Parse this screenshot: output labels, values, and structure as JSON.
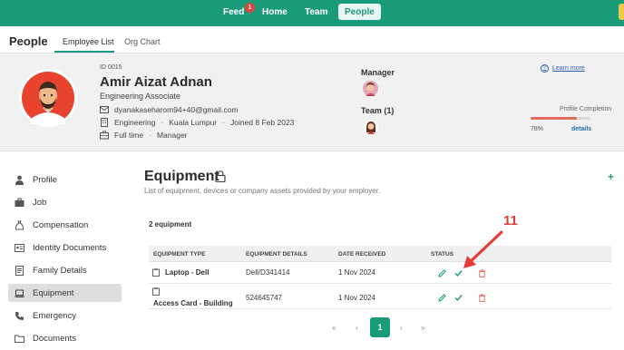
{
  "colors": {
    "brand": "#1a9b7a",
    "badge": "#e0433a",
    "delete": "#e36a5a",
    "link": "#2d5fb7",
    "annotation": "#e53935"
  },
  "topnav": {
    "items": [
      {
        "label": "Feed",
        "badge": "1"
      },
      {
        "label": "Home"
      },
      {
        "label": "Team"
      },
      {
        "label": "People",
        "active": true
      }
    ]
  },
  "page": {
    "title": "People",
    "tabs": [
      {
        "label": "Employee List",
        "active": true
      },
      {
        "label": "Org Chart"
      }
    ]
  },
  "profile": {
    "id": "ID 0015",
    "name": "Amir Aizat Adnan",
    "role": "Engineering Associate",
    "email": "dyanakaseharom94+40@gmail.com",
    "department": "Engineering",
    "location": "Kuala Lumpur",
    "joined": "Joined 8 Feb 2023",
    "employment_type": "Full time",
    "position_level": "Manager",
    "manager_label": "Manager",
    "team_label": "Team (1)",
    "learn_more": "Learn more",
    "completion_label": "Profile Completion",
    "completion_value": "78%",
    "completion_fraction": 0.78,
    "details_link": "details"
  },
  "sidebar": {
    "items": [
      {
        "label": "Profile",
        "icon": "person-icon"
      },
      {
        "label": "Job",
        "icon": "briefcase-icon"
      },
      {
        "label": "Compensation",
        "icon": "money-bag-icon"
      },
      {
        "label": "Identity Documents",
        "icon": "id-card-icon"
      },
      {
        "label": "Family Details",
        "icon": "document-icon"
      },
      {
        "label": "Equipment",
        "icon": "laptop-icon",
        "active": true
      },
      {
        "label": "Emergency",
        "icon": "phone-icon"
      },
      {
        "label": "Documents",
        "icon": "folder-icon"
      }
    ]
  },
  "main": {
    "title": "Equipment",
    "description": "List of equipment, devices or company assets provided by your employer.",
    "count": "2 equipment",
    "add_label": "+",
    "columns": [
      "EQUIPMENT TYPE",
      "EQUIPMENT DETAILS",
      "DATE RECEIVED",
      "STATUS"
    ],
    "rows": [
      {
        "type": "Laptop - Dell",
        "details": "Dell/D341414",
        "date": "1 Nov 2024"
      },
      {
        "type": "Access Card - Building",
        "details": "524645747",
        "date": "1 Nov 2024"
      }
    ]
  },
  "pagination": {
    "first": "«",
    "prev": "‹",
    "current": "1",
    "next": "›",
    "last": "»"
  },
  "annotation": {
    "number": "11"
  }
}
